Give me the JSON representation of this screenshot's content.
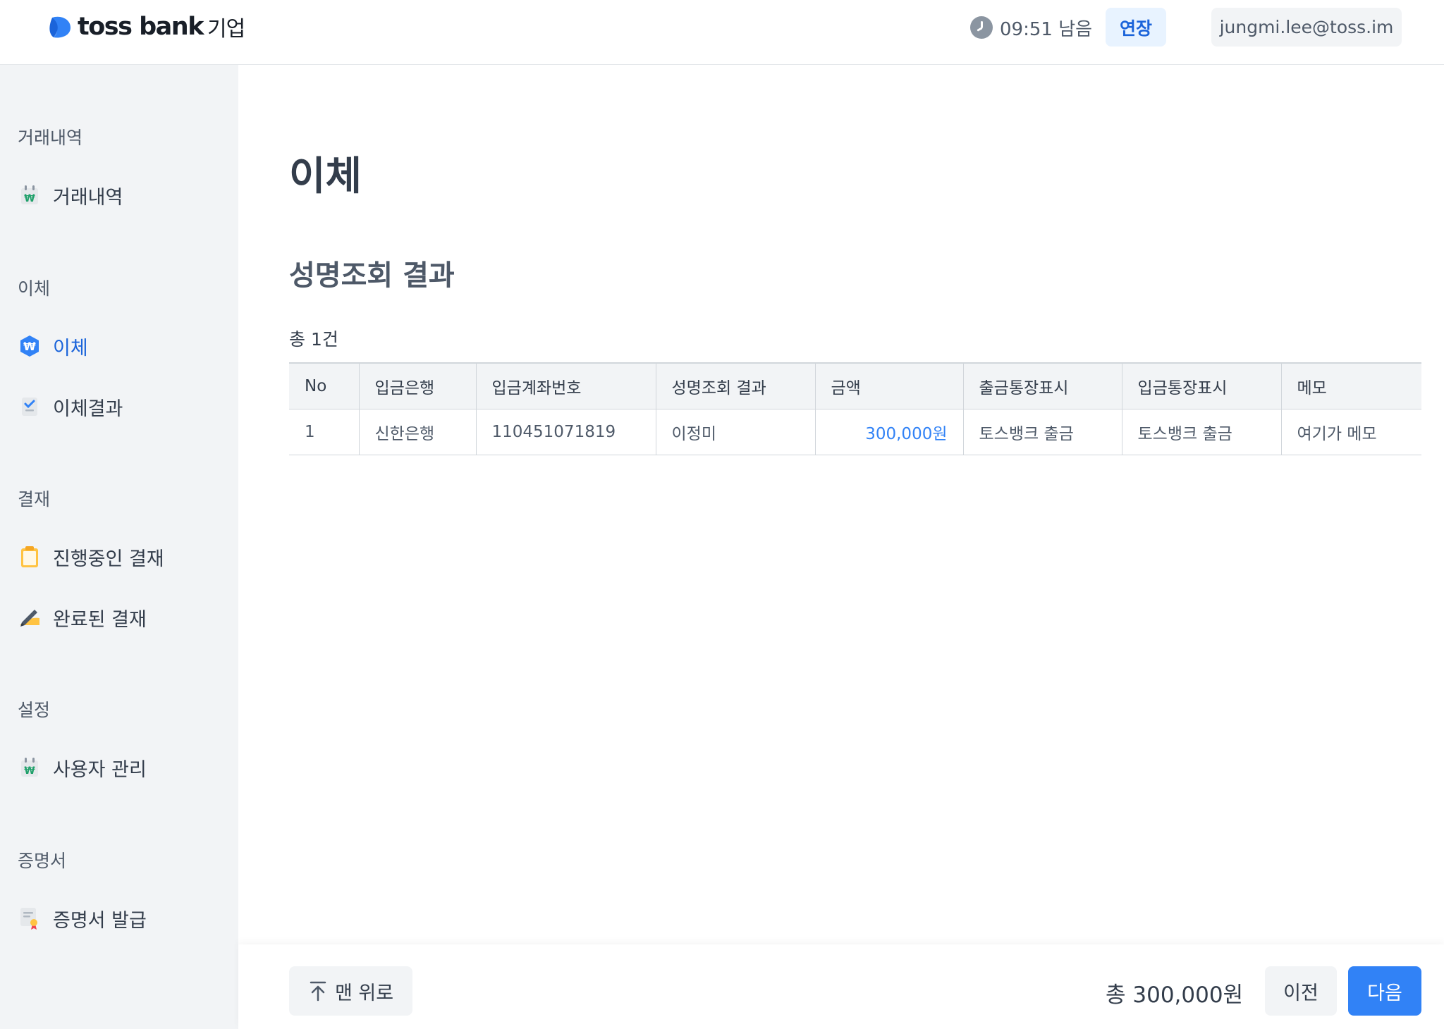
{
  "header": {
    "logo_text": "toss bank",
    "logo_sub": "기업",
    "timer_text": "09:51 남음",
    "extend_label": "연장",
    "user_email": "jungmi.lee@toss.im"
  },
  "sidebar": {
    "sections": [
      {
        "title": "거래내역",
        "items": [
          {
            "label": "거래내역",
            "icon": "won-calendar-icon"
          }
        ]
      },
      {
        "title": "이체",
        "items": [
          {
            "label": "이체",
            "icon": "won-badge-icon",
            "active": true
          },
          {
            "label": "이체결과",
            "icon": "check-doc-icon"
          }
        ]
      },
      {
        "title": "결재",
        "items": [
          {
            "label": "진행중인 결재",
            "icon": "clipboard-icon"
          },
          {
            "label": "완료된 결재",
            "icon": "pen-icon"
          }
        ]
      },
      {
        "title": "설정",
        "items": [
          {
            "label": "사용자 관리",
            "icon": "won-calendar-icon"
          }
        ]
      },
      {
        "title": "증명서",
        "items": [
          {
            "label": "증명서 발급",
            "icon": "certificate-icon"
          }
        ]
      }
    ]
  },
  "main": {
    "page_title": "이체",
    "section_title": "성명조회 결과",
    "count_text": "총 1건",
    "table": {
      "headers": [
        "No",
        "입금은행",
        "입금계좌번호",
        "성명조회 결과",
        "금액",
        "출금통장표시",
        "입금통장표시",
        "메모"
      ],
      "rows": [
        [
          "1",
          "신한은행",
          "110451071819",
          "이정미",
          "300,000원",
          "토스뱅크 출금",
          "토스뱅크 출금",
          "여기가 메모"
        ]
      ]
    }
  },
  "footer": {
    "top_label": "맨 위로",
    "total_text": "총 300,000원",
    "prev_label": "이전",
    "next_label": "다음"
  },
  "colors": {
    "accent": "#3182f6",
    "accent_dark": "#1b64da",
    "sidebar_bg": "#f2f4f6"
  }
}
